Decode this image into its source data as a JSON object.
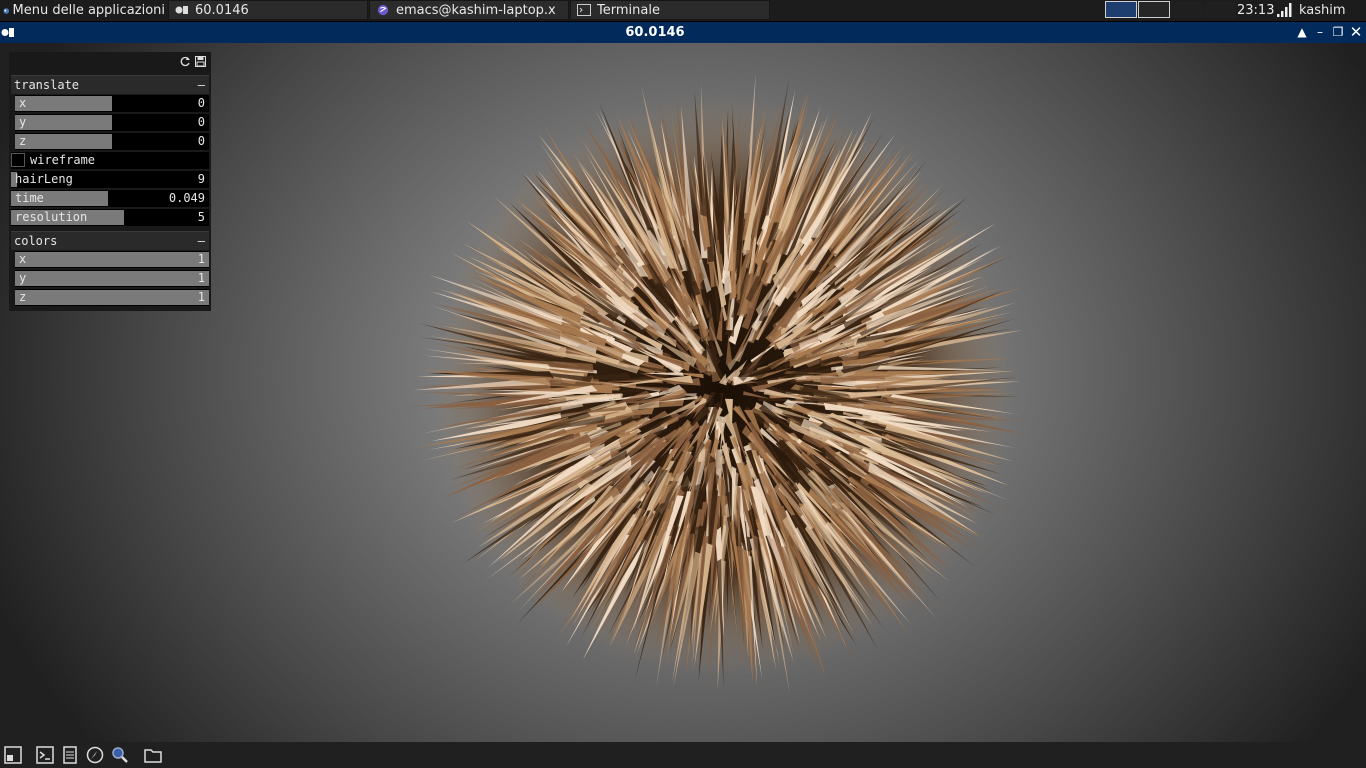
{
  "taskbar": {
    "menu_label": "Menu delle applicazioni",
    "tasks": [
      {
        "label": "60.0146",
        "icon": "of-app-icon"
      },
      {
        "label": "emacs@kashim-laptop.x",
        "icon": "emacs-icon"
      },
      {
        "label": "Terminale",
        "icon": "terminal-icon"
      }
    ],
    "clock": "23:13",
    "user": "kashim"
  },
  "window": {
    "title": "60.0146"
  },
  "gui": {
    "translate": {
      "header": "translate",
      "minimize": "–",
      "x": {
        "label": "x",
        "value": "0",
        "level": 0.5
      },
      "y": {
        "label": "y",
        "value": "0",
        "level": 0.5
      },
      "z": {
        "label": "z",
        "value": "0",
        "level": 0.5
      }
    },
    "wireframe": {
      "label": "wireframe",
      "checked": false
    },
    "hairLeng": {
      "label": "hairLeng",
      "value": "9",
      "level": 0.03
    },
    "time": {
      "label": "time",
      "value": "0.049",
      "level": 0.49
    },
    "resolution": {
      "label": "resolution",
      "value": "5",
      "level": 0.57
    },
    "colors": {
      "header": "colors",
      "minimize": "–",
      "x": {
        "label": "x",
        "value": "1",
        "level": 1
      },
      "y": {
        "label": "y",
        "value": "1",
        "level": 1
      },
      "z": {
        "label": "z",
        "value": "1",
        "level": 1
      }
    }
  },
  "colors": {
    "titlebar": "#022a5a",
    "hair_light": "#f2dcc4",
    "hair_mid": "#a87a50",
    "hair_dark": "#3a2412"
  }
}
